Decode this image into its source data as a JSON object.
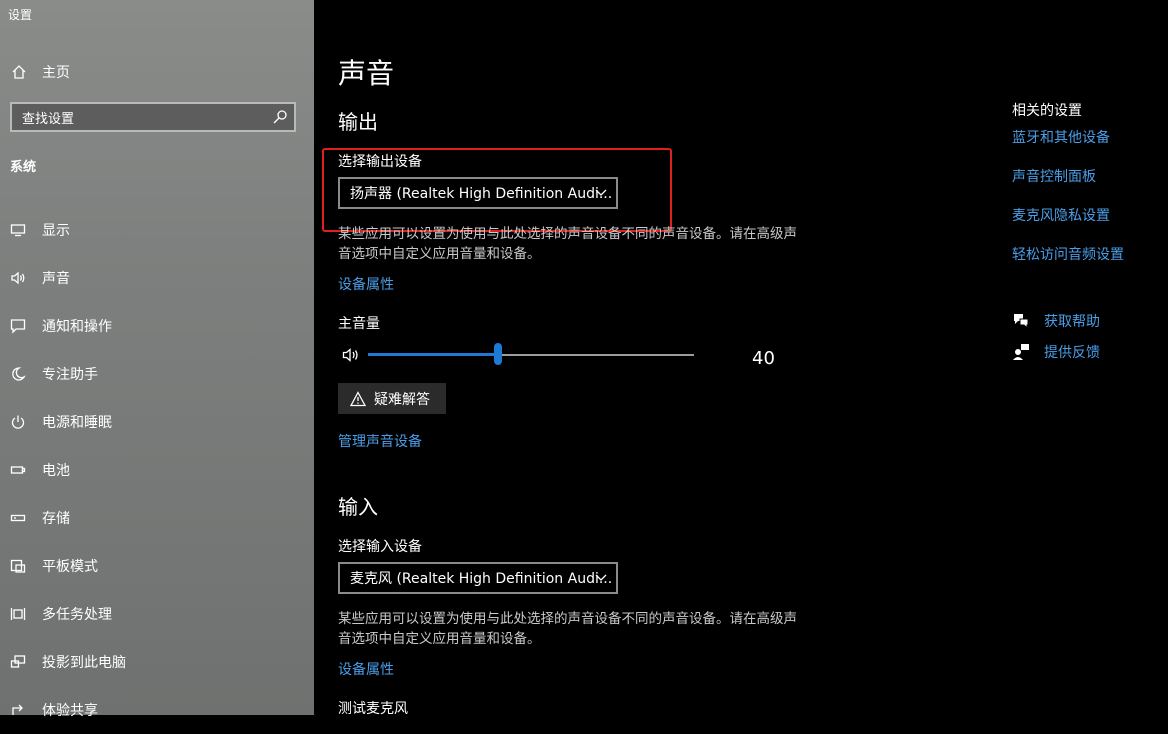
{
  "window": {
    "title": "设置"
  },
  "sidebar": {
    "home_label": "主页",
    "search_placeholder": "查找设置",
    "section_label": "系统",
    "items": [
      {
        "label": "显示",
        "icon": "monitor-icon"
      },
      {
        "label": "声音",
        "icon": "speaker-icon"
      },
      {
        "label": "通知和操作",
        "icon": "notification-icon"
      },
      {
        "label": "专注助手",
        "icon": "moon-icon"
      },
      {
        "label": "电源和睡眠",
        "icon": "power-icon"
      },
      {
        "label": "电池",
        "icon": "battery-icon"
      },
      {
        "label": "存储",
        "icon": "storage-icon"
      },
      {
        "label": "平板模式",
        "icon": "tablet-icon"
      },
      {
        "label": "多任务处理",
        "icon": "multitask-icon"
      },
      {
        "label": "投影到此电脑",
        "icon": "project-icon"
      },
      {
        "label": "体验共享",
        "icon": "share-icon"
      }
    ]
  },
  "main": {
    "page_title": "声音",
    "output": {
      "heading": "输出",
      "device_label": "选择输出设备",
      "device_value": "扬声器 (Realtek High Definition Audi...",
      "description": "某些应用可以设置为使用与此处选择的声音设备不同的声音设备。请在高级声音选项中自定义应用音量和设备。",
      "properties_link": "设备属性",
      "volume_label": "主音量",
      "volume_value": "40",
      "troubleshoot_label": "疑难解答",
      "manage_link": "管理声音设备"
    },
    "input": {
      "heading": "输入",
      "device_label": "选择输入设备",
      "device_value": "麦克风 (Realtek High Definition Audi...",
      "description": "某些应用可以设置为使用与此处选择的声音设备不同的声音设备。请在高级声音选项中自定义应用音量和设备。",
      "properties_link": "设备属性",
      "test_label": "测试麦克风"
    }
  },
  "related": {
    "heading": "相关的设置",
    "links": [
      "蓝牙和其他设备",
      "声音控制面板",
      "麦克风隐私设置",
      "轻松访问音频设置"
    ],
    "help_label": "获取帮助",
    "feedback_label": "提供反馈"
  },
  "colors": {
    "accent": "#1f7ad6",
    "link": "#4a9ee8",
    "highlight_box": "#e02020"
  }
}
